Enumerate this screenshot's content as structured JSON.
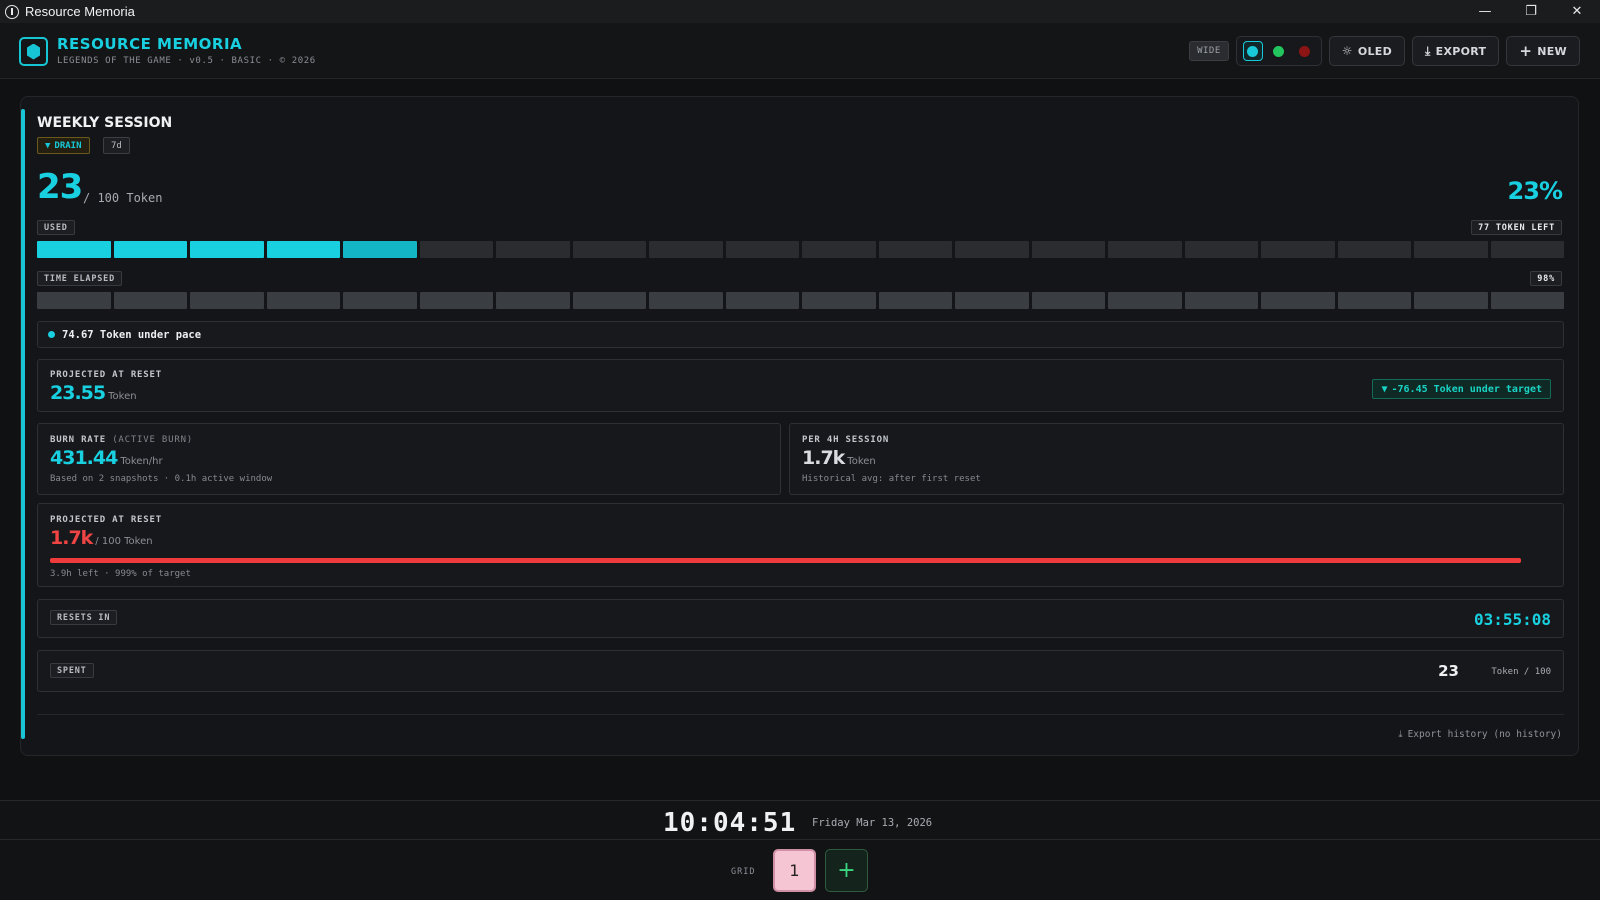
{
  "window": {
    "title": "Resource Memoria",
    "controls": {
      "minimize": "—",
      "maximize": "❐",
      "close": "✕"
    }
  },
  "header": {
    "app_title": "RESOURCE MEMORIA",
    "subtitle": "LEGENDS OF THE GAME · v0.5 · BASIC · © 2026",
    "wide_label": "WIDE",
    "themes": [
      {
        "name": "cyan",
        "color": "#19c9d8",
        "active": true
      },
      {
        "name": "green",
        "color": "#22c55e",
        "active": false
      },
      {
        "name": "red",
        "color": "#8b1414",
        "active": false
      }
    ],
    "oled_label": "OLED",
    "export_label": "EXPORT",
    "new_label": "NEW"
  },
  "card": {
    "title": "WEEKLY SESSION",
    "tag_drain": "DRAIN",
    "tag_period": "7d",
    "used_value": "23",
    "used_of": "/ 100 Token",
    "used_pct": "23%",
    "used_label": "USED",
    "tokens_left": "77 TOKEN LEFT",
    "used_bar": {
      "segments": 20,
      "filled": 5,
      "fill_color": "#18d0e0",
      "last_fill_color": "#12b6c5",
      "empty_color": "#2a2c30"
    },
    "time_label": "TIME ELAPSED",
    "time_pct": "98%",
    "time_bar": {
      "segments": 20,
      "filled": 20,
      "fill_color": "#3a3d42"
    },
    "pace_text": "74.67 Token under pace",
    "projected": {
      "label": "PROJECTED AT RESET",
      "value": "23.55",
      "unit": "Token",
      "delta": "-76.45 Token under target"
    },
    "burn": {
      "label": "BURN RATE",
      "label_muted": "(ACTIVE BURN)",
      "value": "431.44",
      "unit": "Token/hr",
      "note": "Based on 2 snapshots · 0.1h active window"
    },
    "per4h": {
      "label": "PER 4H SESSION",
      "value": "1.7k",
      "unit": "Token",
      "note": "Historical avg: after first reset"
    },
    "projected2": {
      "label": "PROJECTED AT RESET",
      "value": "1.7k",
      "unit": "/ 100 Token",
      "note": "3.9h left · 999% of target",
      "bar_fraction": 1.0,
      "bar_color": "#ef3b3b"
    },
    "resets": {
      "label": "RESETS IN",
      "time": "03:55:08"
    },
    "spent": {
      "label": "SPENT",
      "value": "23",
      "unit": "Token / 100"
    },
    "export_history": "Export history (no history)"
  },
  "footer": {
    "clock": "10:04:51",
    "date": "Friday Mar 13, 2026",
    "grid_label": "GRID",
    "grid_buttons": [
      "1"
    ],
    "add_label": "+"
  }
}
